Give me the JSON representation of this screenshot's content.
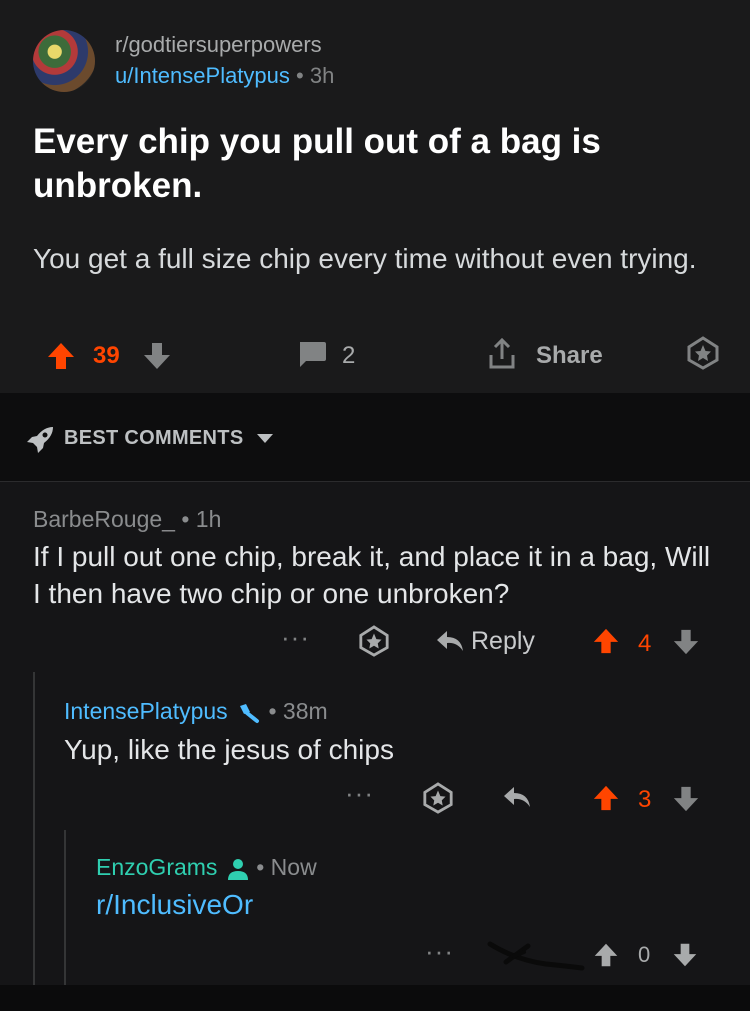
{
  "post": {
    "subreddit": "r/godtiersuperpowers",
    "author": "u/IntensePlatypus",
    "time": "3h",
    "title": "Every chip you pull out of a bag is unbroken.",
    "body": "You get a full size chip every time without even trying.",
    "votes": "39",
    "comments": "2",
    "share_label": "Share"
  },
  "sort": {
    "label": "BEST COMMENTS"
  },
  "comments": [
    {
      "author": "BarbeRouge_",
      "time": "1h",
      "text": "If I pull out one chip, break it, and  place it in a bag, Will I then have two chip or one unbroken?",
      "reply_label": "Reply",
      "votes": "4"
    },
    {
      "author": "IntensePlatypus",
      "time": "38m",
      "text": "Yup, like the jesus of chips",
      "votes": "3"
    },
    {
      "author": "EnzoGrams",
      "time": "Now",
      "text": "r/InclusiveOr",
      "votes": "0"
    }
  ],
  "colors": {
    "upvote": "#ff4500",
    "link": "#4fbcff",
    "op": "#2fcfb0"
  }
}
